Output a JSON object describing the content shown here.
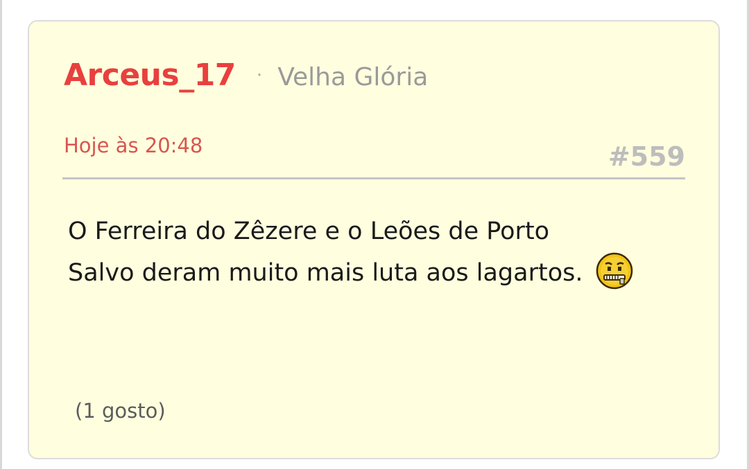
{
  "post": {
    "username": "Arceus_17",
    "separator": "·",
    "rank": "Velha Glória",
    "date": "Hoje às 20:48",
    "number": "#559",
    "body_line1": "O Ferreira do Zêzere e o Leões de Porto",
    "body_line2": "Salvo deram muito mais luta aos lagartos.",
    "emoji": "zipper-mouth-smiley-icon",
    "likes": "(1 gosto)"
  },
  "colors": {
    "card_background": "#ffffdf",
    "username": "#e8403e",
    "date": "#d95550",
    "rank": "#9a9a9a",
    "post_number": "#bdbdbd"
  }
}
